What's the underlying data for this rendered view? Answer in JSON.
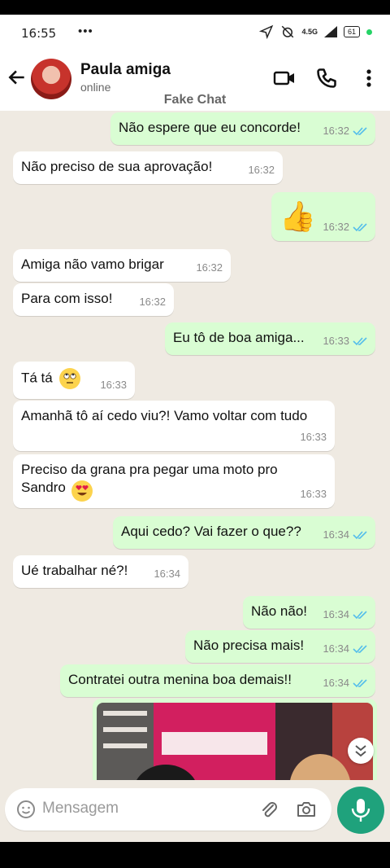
{
  "status_bar": {
    "time": "16:55",
    "extra": "•••",
    "network": "4.5G",
    "battery": "61"
  },
  "header": {
    "contact_name": "Paula amiga",
    "contact_status": "online",
    "watermark": "Fake Chat"
  },
  "icons": {
    "back": "arrow-left-icon",
    "video": "video-call-icon",
    "call": "phone-icon",
    "menu": "more-vert-icon",
    "emoji": "emoji-icon",
    "attach": "attach-icon",
    "camera": "camera-icon",
    "mic": "mic-icon",
    "scroll": "scroll-down-icon"
  },
  "colors": {
    "incoming": "#ffffff",
    "outgoing": "#d9fdd3",
    "accent": "#1fa27c",
    "read_ticks": "#53bdeb",
    "chat_bg": "#efeae2"
  },
  "messages": [
    {
      "dir": "out",
      "text": "Não espere que eu concorde!",
      "time": "16:32",
      "read": true
    },
    {
      "dir": "in",
      "text": "Não preciso de sua aprovação!",
      "time": "16:32"
    },
    {
      "dir": "out",
      "text": "👍",
      "time": "16:32",
      "read": true
    },
    {
      "dir": "in",
      "text": "Amiga não vamo brigar",
      "time": "16:32"
    },
    {
      "dir": "in",
      "text": "Para com isso!",
      "time": "16:32"
    },
    {
      "dir": "out",
      "text": "Eu tô de boa amiga...",
      "time": "16:33",
      "read": true
    },
    {
      "dir": "in",
      "text": "Tá tá",
      "emoji": "eye-roll-emoji",
      "time": "16:33"
    },
    {
      "dir": "in",
      "text": "Amanhã tô aí cedo viu?! Vamo voltar com tudo",
      "time": "16:33"
    },
    {
      "dir": "in",
      "text": "Preciso da grana pra pegar uma moto pro Sandro",
      "emoji": "heart-eyes-emoji",
      "time": "16:33"
    },
    {
      "dir": "out",
      "text": "Aqui cedo? Vai fazer o que??",
      "time": "16:34",
      "read": true
    },
    {
      "dir": "in",
      "text": "Ué trabalhar né?!",
      "time": "16:34"
    },
    {
      "dir": "out",
      "text": "Não não!",
      "time": "16:34",
      "read": true
    },
    {
      "dir": "out",
      "text": "Não precisa mais!",
      "time": "16:34",
      "read": true
    },
    {
      "dir": "out",
      "text": "Contratei outra menina boa demais!!",
      "time": "16:34",
      "read": true
    },
    {
      "dir": "out",
      "media": "photo",
      "time": ""
    }
  ],
  "input": {
    "placeholder": "Mensagem"
  }
}
